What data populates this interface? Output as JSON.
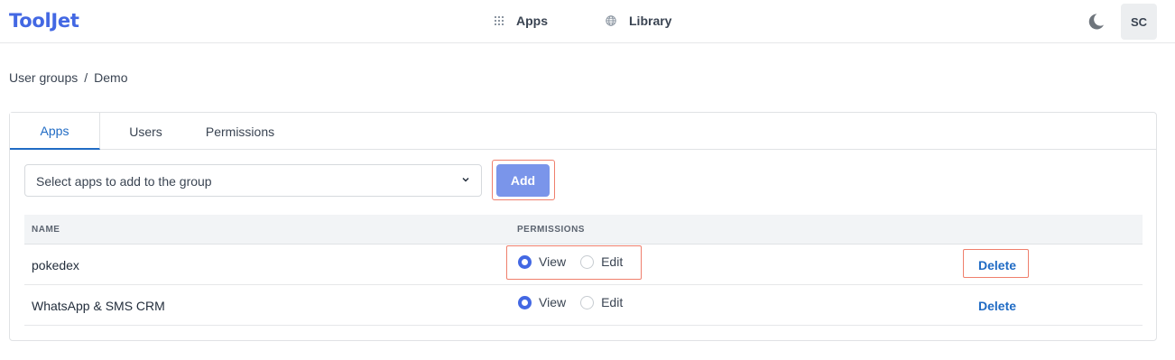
{
  "brand": {
    "logo_text": "ToolJet",
    "accent": "#4368e3"
  },
  "nav": {
    "apps_label": "Apps",
    "library_label": "Library",
    "theme_icon": "moon-icon",
    "avatar_initials": "SC"
  },
  "breadcrumb": {
    "parent": "User groups",
    "separator": "/",
    "current": "Demo"
  },
  "tabs": [
    {
      "label": "Apps",
      "active": true
    },
    {
      "label": "Users",
      "active": false
    },
    {
      "label": "Permissions",
      "active": false
    }
  ],
  "app_select": {
    "placeholder": "Select apps to add to the group"
  },
  "add_button": {
    "label": "Add"
  },
  "table": {
    "columns": [
      "NAME",
      "PERMISSIONS"
    ],
    "rows": [
      {
        "name": "pokedex",
        "view_label": "View",
        "edit_label": "Edit",
        "selected": "view",
        "delete_label": "Delete"
      },
      {
        "name": "WhatsApp & SMS CRM",
        "view_label": "View",
        "edit_label": "Edit",
        "selected": "view",
        "delete_label": "Delete"
      }
    ]
  },
  "colors": {
    "link": "#206bc4",
    "highlight": "#ef7f6c",
    "add_button_bg": "#7a95ea"
  }
}
